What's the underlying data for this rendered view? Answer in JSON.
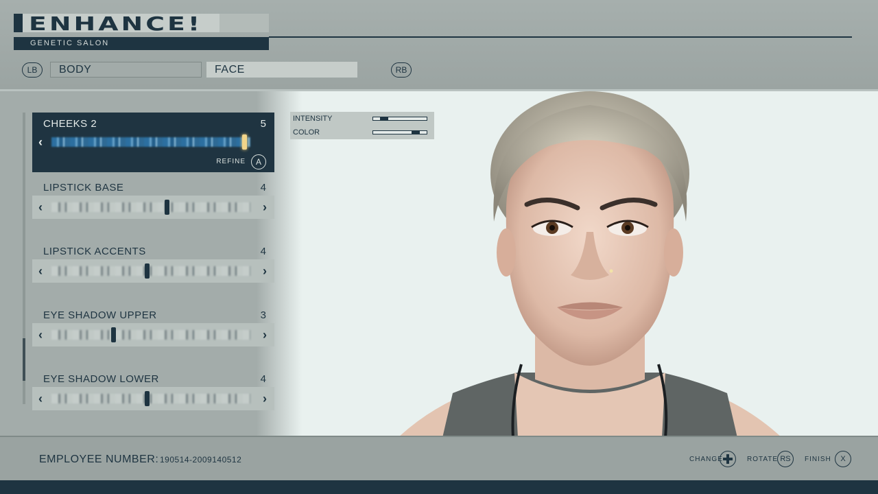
{
  "header": {
    "logo": "ENHANCE!",
    "subtitle": "GENETIC SALON",
    "prev_tab_hint": "LB",
    "next_tab_hint": "RB",
    "tabs": [
      {
        "label": "BODY"
      },
      {
        "label": "FACE"
      }
    ]
  },
  "sliders": [
    {
      "label": "CHEEKS 2",
      "value": "5",
      "position": 0.97,
      "selected": true,
      "refine_label": "REFINE",
      "refine_button": "A"
    },
    {
      "label": "LIPSTICK BASE",
      "value": "4",
      "position": 0.58
    },
    {
      "label": "LIPSTICK ACCENTS",
      "value": "4",
      "position": 0.48
    },
    {
      "label": "EYE SHADOW UPPER",
      "value": "3",
      "position": 0.31
    },
    {
      "label": "EYE SHADOW LOWER",
      "value": "4",
      "position": 0.48
    }
  ],
  "refine_panel": {
    "intensity_label": "INTENSITY",
    "intensity_level": 0.2,
    "color_label": "COLOR",
    "color_level": 0.8
  },
  "footer": {
    "employee_label": "EMPLOYEE NUMBER:",
    "employee_number": "190514-2009140512",
    "change_label": "CHANGE",
    "rotate_label": "ROTATE",
    "rotate_button": "RS",
    "finish_label": "FINISH",
    "finish_button": "X"
  },
  "colors": {
    "accent_dark": "#1e3441",
    "panel": "#9aa3a1",
    "preview_bg": "#e9f1ef"
  }
}
